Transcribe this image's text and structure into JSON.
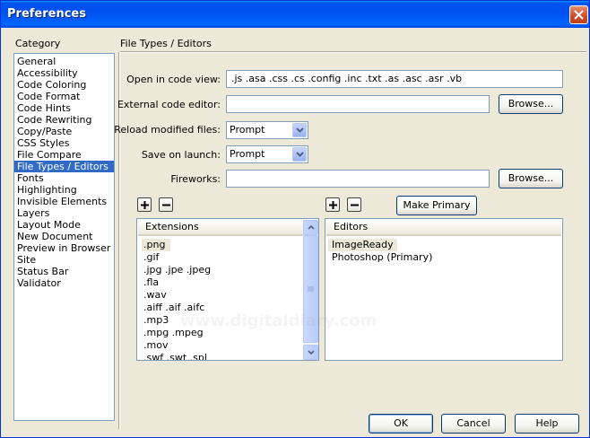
{
  "window": {
    "title": "Preferences"
  },
  "category": {
    "label": "Category",
    "items": [
      "General",
      "Accessibility",
      "Code Coloring",
      "Code Format",
      "Code Hints",
      "Code Rewriting",
      "Copy/Paste",
      "CSS Styles",
      "File Compare",
      "File Types / Editors",
      "Fonts",
      "Highlighting",
      "Invisible Elements",
      "Layers",
      "Layout Mode",
      "New Document",
      "Preview in Browser",
      "Site",
      "Status Bar",
      "Validator"
    ],
    "selected": "File Types / Editors"
  },
  "panel": {
    "title": "File Types / Editors",
    "open_in_code_view": {
      "label": "Open in code view:",
      "value": ".js .asa .css .cs .config .inc .txt .as .asc .asr .vb"
    },
    "external_code_editor": {
      "label": "External code editor:",
      "value": ""
    },
    "reload_modified_files": {
      "label": "Reload modified files:",
      "value": "Prompt"
    },
    "save_on_launch": {
      "label": "Save on launch:",
      "value": "Prompt"
    },
    "fireworks": {
      "label": "Fireworks:",
      "value": ""
    },
    "browse_label": "Browse...",
    "make_primary_label": "Make Primary"
  },
  "extensions": {
    "header": "Extensions",
    "items": [
      ".png",
      ".gif",
      ".jpg .jpe .jpeg",
      ".fla",
      ".wav",
      ".aiff .aif .aifc",
      ".mp3",
      ".mpg .mpeg",
      ".mov",
      ".swf .swt .spl"
    ]
  },
  "editors": {
    "header": "Editors",
    "items": [
      "ImageReady",
      "Photoshop (Primary)"
    ]
  },
  "footer": {
    "ok": "OK",
    "cancel": "Cancel",
    "help": "Help"
  },
  "watermark": "www.digitaldiary.com",
  "colors": {
    "accent": "#316ac5",
    "titlebar": "#0053ee",
    "face": "#ece9d8"
  }
}
